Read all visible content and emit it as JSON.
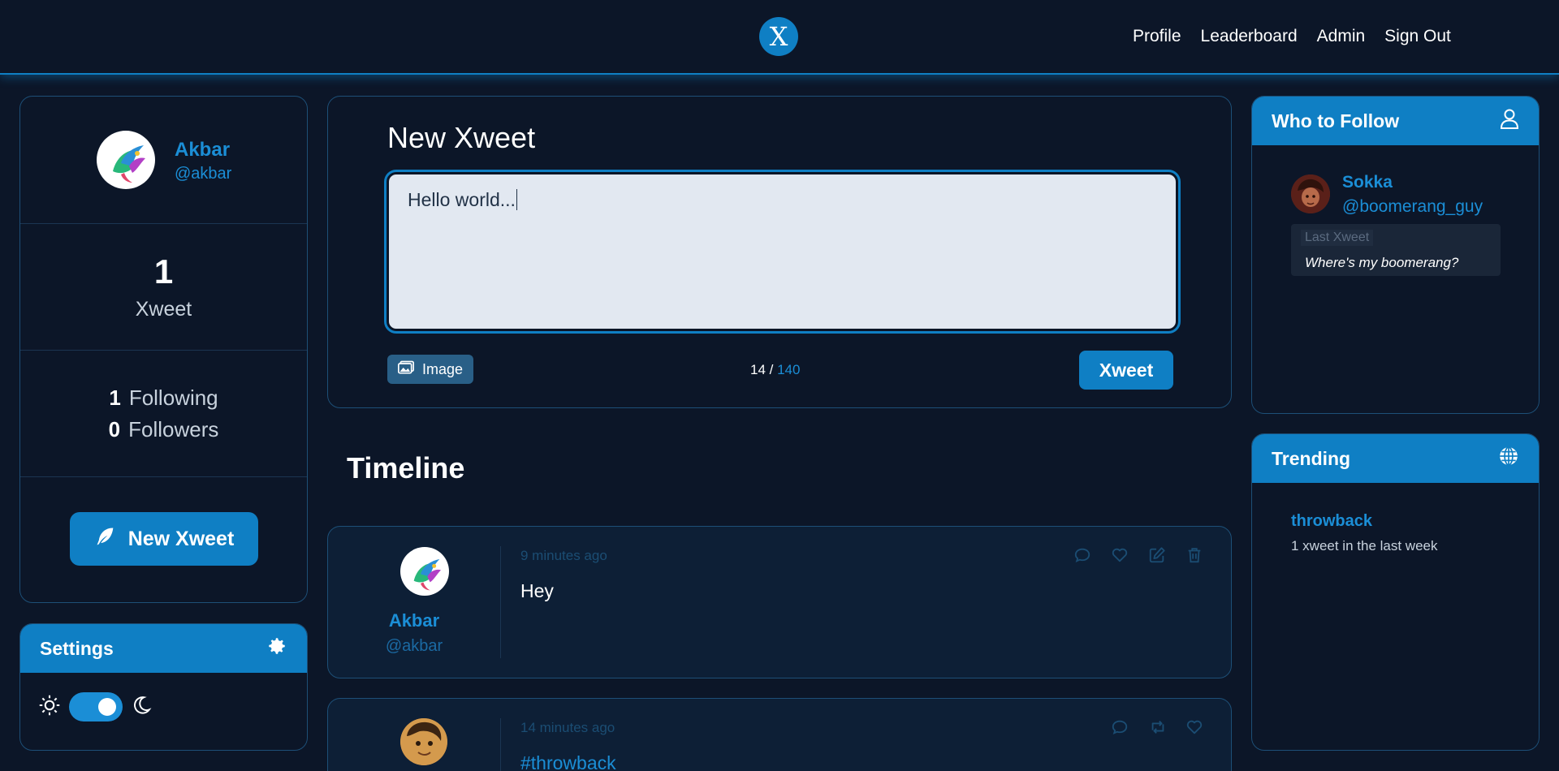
{
  "nav": {
    "logo": "X",
    "links": [
      "Profile",
      "Leaderboard",
      "Admin",
      "Sign Out"
    ]
  },
  "profile": {
    "name": "Akbar",
    "handle": "@akbar",
    "xweet_count": "1",
    "xweet_label": "Xweet",
    "following_count": "1",
    "following_label": "Following",
    "followers_count": "0",
    "followers_label": "Followers",
    "new_xweet_label": "New Xweet"
  },
  "settings": {
    "title": "Settings",
    "dark_mode": true
  },
  "compose": {
    "title": "New Xweet",
    "text": "Hello world...",
    "image_label": "Image",
    "count": "14",
    "max": "140",
    "submit_label": "Xweet"
  },
  "timeline": {
    "title": "Timeline",
    "xweets": [
      {
        "name": "Akbar",
        "handle": "@akbar",
        "time": "9 minutes ago",
        "text": "Hey"
      },
      {
        "time": "14 minutes ago",
        "text": "#throwback"
      }
    ]
  },
  "who_to_follow": {
    "title": "Who to Follow",
    "name": "Sokka",
    "handle": "@boomerang_guy",
    "last_label": "Last Xweet",
    "last_text": "Where's my boomerang?"
  },
  "trending": {
    "title": "Trending",
    "tag": "throwback",
    "count_text": "1 xweet in the last week"
  },
  "colors": {
    "accent": "#0f7fc4",
    "background": "#0c1628",
    "card_alt": "#0d1f36"
  }
}
